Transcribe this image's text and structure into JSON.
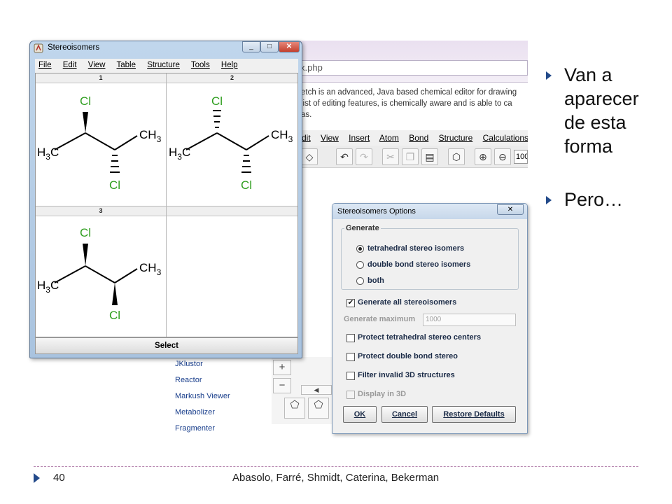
{
  "background_app": {
    "url_fragment": "x.php",
    "description_lines": [
      "etch is an advanced, Java based chemical editor for drawing",
      "list of editing features, is chemically aware and is able to ca",
      "as."
    ],
    "menu": [
      "dit",
      "View",
      "Insert",
      "Atom",
      "Bond",
      "Structure",
      "Calculations"
    ],
    "zoom_value": "100",
    "links": [
      "JKlustor",
      "Reactor",
      "Markush Viewer",
      "Metabolizer",
      "Fragmenter"
    ]
  },
  "stereo_window": {
    "title": "Stereoisomers",
    "menu": [
      "File",
      "Edit",
      "View",
      "Table",
      "Structure",
      "Tools",
      "Help"
    ],
    "cell_headers": [
      "1",
      "2",
      "3"
    ],
    "atom_labels": {
      "cl": "Cl",
      "h3c": "H",
      "h3c_sub": "3",
      "h3c_c": "C",
      "ch3_c": "CH",
      "ch3_sub": "3"
    },
    "select_button": "Select"
  },
  "options_dialog": {
    "title": "Stereoisomers Options",
    "generate_legend": "Generate",
    "radios": [
      {
        "label": "tetrahedral stereo isomers",
        "selected": true
      },
      {
        "label": "double bond stereo isomers",
        "selected": false
      },
      {
        "label": "both",
        "selected": false
      }
    ],
    "generate_all": {
      "label": "Generate all stereoisomers",
      "checked": true
    },
    "generate_max": {
      "label": "Generate maximum",
      "value": "1000"
    },
    "checkboxes": [
      {
        "label": "Protect tetrahedral stereo centers",
        "checked": false
      },
      {
        "label": "Protect double bond stereo",
        "checked": false
      },
      {
        "label": "Filter invalid 3D structures",
        "checked": false
      },
      {
        "label": "Display in 3D",
        "checked": false,
        "disabled": true
      }
    ],
    "buttons": {
      "ok": "OK",
      "cancel": "Cancel",
      "restore": "Restore Defaults"
    }
  },
  "slide": {
    "bullets": [
      [
        "Van a",
        "aparecer",
        "de esta",
        "forma"
      ],
      [
        "Pero…"
      ]
    ],
    "page_number": "40",
    "authors": "Abasolo, Farré, Shmidt, Caterina, Bekerman",
    "accent_color": "#234a8a",
    "chlorine_color": "#2e9e1e"
  }
}
